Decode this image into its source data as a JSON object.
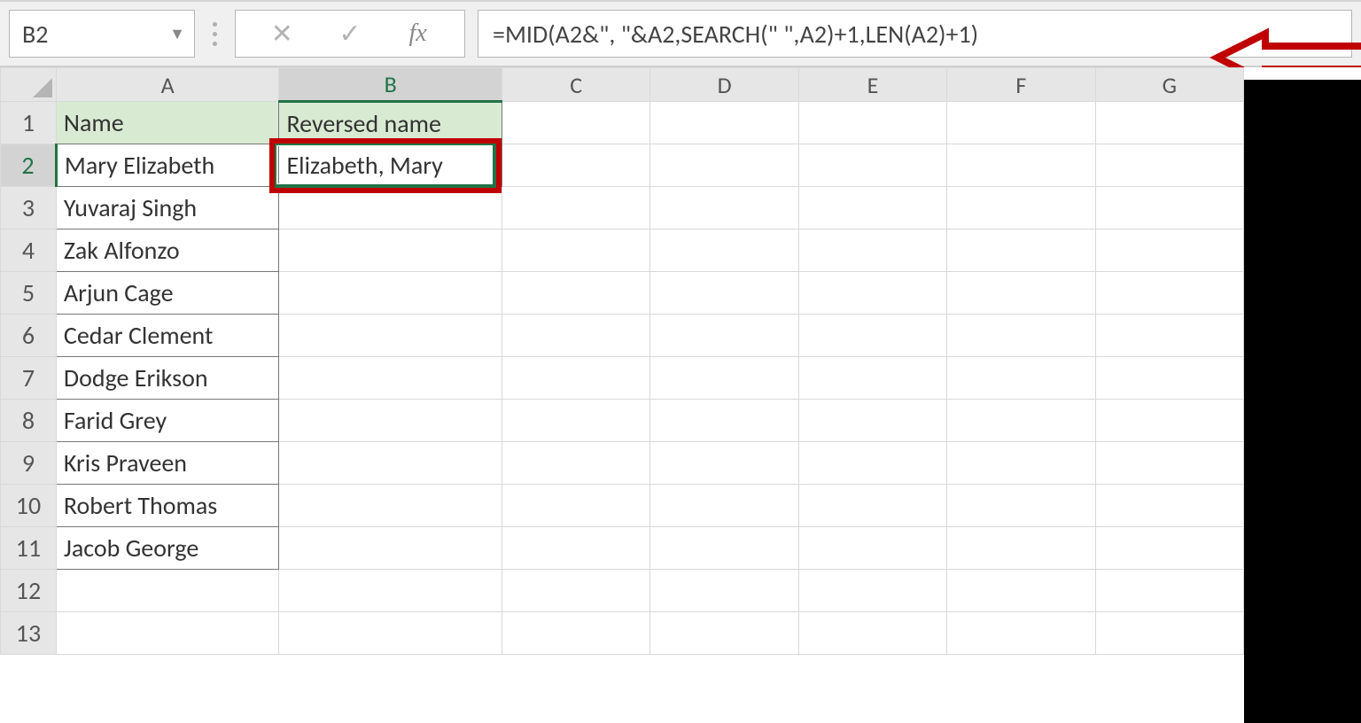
{
  "formula_bar": {
    "cell_ref": "B2",
    "cancel_glyph": "✕",
    "enter_glyph": "✓",
    "fx_label": "fx",
    "formula": "=MID(A2&\", \"&A2,SEARCH(\" \",A2)+1,LEN(A2)+1)"
  },
  "columns": [
    "A",
    "B",
    "C",
    "D",
    "E",
    "F",
    "G"
  ],
  "active": {
    "col": "B",
    "row": 2
  },
  "headers": {
    "A": "Name",
    "B": "Reversed name"
  },
  "rows": [
    {
      "n": 1,
      "A": "Name",
      "B": "Reversed name"
    },
    {
      "n": 2,
      "A": "Mary Elizabeth",
      "B": "Elizabeth, Mary"
    },
    {
      "n": 3,
      "A": "Yuvaraj Singh",
      "B": ""
    },
    {
      "n": 4,
      "A": "Zak Alfonzo",
      "B": ""
    },
    {
      "n": 5,
      "A": "Arjun Cage",
      "B": ""
    },
    {
      "n": 6,
      "A": "Cedar Clement",
      "B": ""
    },
    {
      "n": 7,
      "A": "Dodge Erikson",
      "B": ""
    },
    {
      "n": 8,
      "A": "Farid Grey",
      "B": ""
    },
    {
      "n": 9,
      "A": "Kris Praveen",
      "B": ""
    },
    {
      "n": 10,
      "A": "Robert Thomas",
      "B": ""
    },
    {
      "n": 11,
      "A": "Jacob George",
      "B": ""
    },
    {
      "n": 12,
      "A": "",
      "B": ""
    },
    {
      "n": 13,
      "A": "",
      "B": ""
    }
  ]
}
